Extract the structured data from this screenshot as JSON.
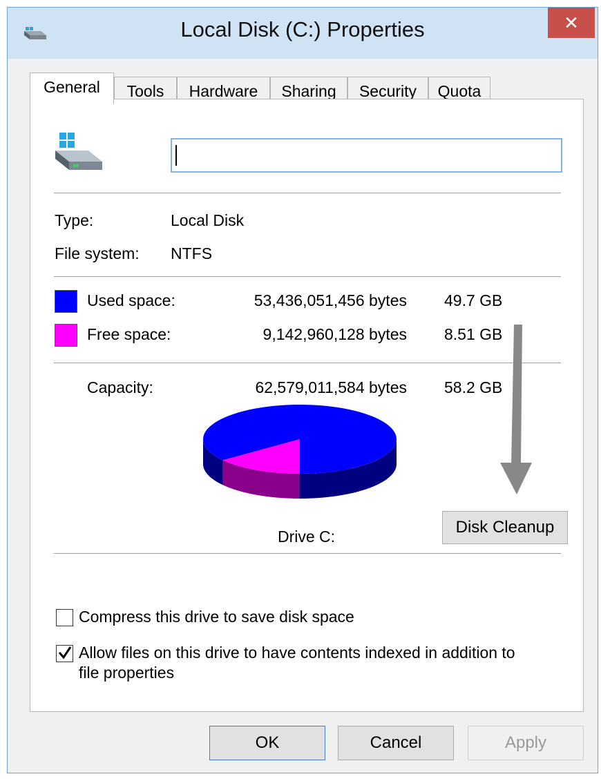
{
  "window": {
    "title": "Local Disk (C:) Properties",
    "close_glyph": "✕",
    "close_color": "#c7504b"
  },
  "tabs": [
    {
      "label": "General",
      "active": true
    },
    {
      "label": "Tools",
      "active": false
    },
    {
      "label": "Hardware",
      "active": false
    },
    {
      "label": "Sharing",
      "active": false
    },
    {
      "label": "Security",
      "active": false
    },
    {
      "label": "Quota",
      "active": false
    }
  ],
  "general": {
    "drive_icon": "drive-icon",
    "name_value": "",
    "type_label": "Type:",
    "type_value": "Local Disk",
    "fs_label": "File system:",
    "fs_value": "NTFS",
    "used": {
      "label": "Used space:",
      "bytes": "53,436,051,456 bytes",
      "size": "49.7 GB",
      "color": "#0000ff"
    },
    "free": {
      "label": "Free space:",
      "bytes": "9,142,960,128 bytes",
      "size": "8.51 GB",
      "color": "#ff00ff"
    },
    "capacity": {
      "label": "Capacity:",
      "bytes": "62,579,011,584 bytes",
      "size": "58.2 GB"
    },
    "drive_label": "Drive C:",
    "disk_cleanup_label": "Disk Cleanup",
    "compress_label": "Compress this drive to save disk space",
    "compress_checked": false,
    "index_label_line1": "Allow files on this drive to have contents indexed in addition to",
    "index_label_line2": "file properties",
    "index_checked": true
  },
  "chart_data": {
    "type": "pie",
    "categories": [
      "Used space",
      "Free space"
    ],
    "values": [
      53436051456,
      9142960128
    ],
    "colors": [
      "#0000ff",
      "#ff00ff"
    ],
    "title": "Drive C:"
  },
  "footer": {
    "ok_label": "OK",
    "cancel_label": "Cancel",
    "apply_label": "Apply"
  }
}
